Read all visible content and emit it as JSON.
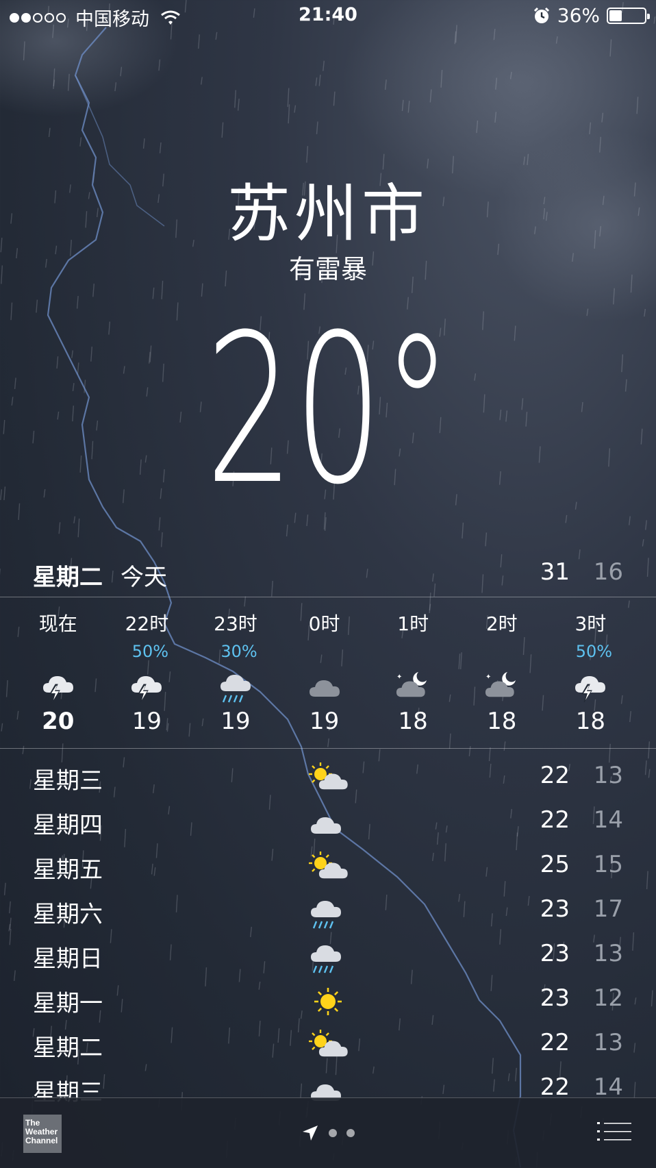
{
  "status_bar": {
    "signal_dots": [
      true,
      true,
      false,
      false,
      false
    ],
    "carrier": "中国移动",
    "time": "21:40",
    "battery_percent": "36%",
    "battery_level": 0.36,
    "icons": [
      "wifi-icon",
      "alarm-icon",
      "battery-icon"
    ]
  },
  "header": {
    "city": "苏州市",
    "condition": "有雷暴",
    "temperature": "20°"
  },
  "today": {
    "day": "星期二",
    "label": "今天",
    "high": "31",
    "low": "16"
  },
  "hourly": [
    {
      "time": "现在",
      "pop": "",
      "icon": "thunderstorm-icon",
      "temp": "20"
    },
    {
      "time": "22时",
      "pop": "50%",
      "icon": "thunderstorm-icon",
      "temp": "19"
    },
    {
      "time": "23时",
      "pop": "30%",
      "icon": "rain-icon",
      "temp": "19"
    },
    {
      "time": "0时",
      "pop": "",
      "icon": "cloud-icon",
      "temp": "19"
    },
    {
      "time": "1时",
      "pop": "",
      "icon": "partly-cloudy-night-icon",
      "temp": "18"
    },
    {
      "time": "2时",
      "pop": "",
      "icon": "partly-cloudy-night-icon",
      "temp": "18"
    },
    {
      "time": "3时",
      "pop": "50%",
      "icon": "thunderstorm-icon",
      "temp": "18"
    }
  ],
  "daily": [
    {
      "day": "星期三",
      "icon": "partly-sunny-icon",
      "high": "22",
      "low": "13"
    },
    {
      "day": "星期四",
      "icon": "cloud-icon",
      "high": "22",
      "low": "14"
    },
    {
      "day": "星期五",
      "icon": "partly-sunny-icon",
      "high": "25",
      "low": "15"
    },
    {
      "day": "星期六",
      "icon": "rain-icon",
      "high": "23",
      "low": "17"
    },
    {
      "day": "星期日",
      "icon": "rain-icon",
      "high": "23",
      "low": "13"
    },
    {
      "day": "星期一",
      "icon": "sun-icon",
      "high": "23",
      "low": "12"
    },
    {
      "day": "星期二",
      "icon": "partly-sunny-icon",
      "high": "22",
      "low": "13"
    },
    {
      "day": "星期三",
      "icon": "cloud-icon",
      "high": "22",
      "low": "14"
    }
  ],
  "bottom_bar": {
    "logo_text": "The Weather Channel",
    "icons": [
      "location-arrow-icon",
      "list-icon"
    ],
    "page_dots": 2
  },
  "colors": {
    "precip": "#5ec2f0",
    "sun": "#ffd31a",
    "low_temp": "#9aa0aa"
  }
}
